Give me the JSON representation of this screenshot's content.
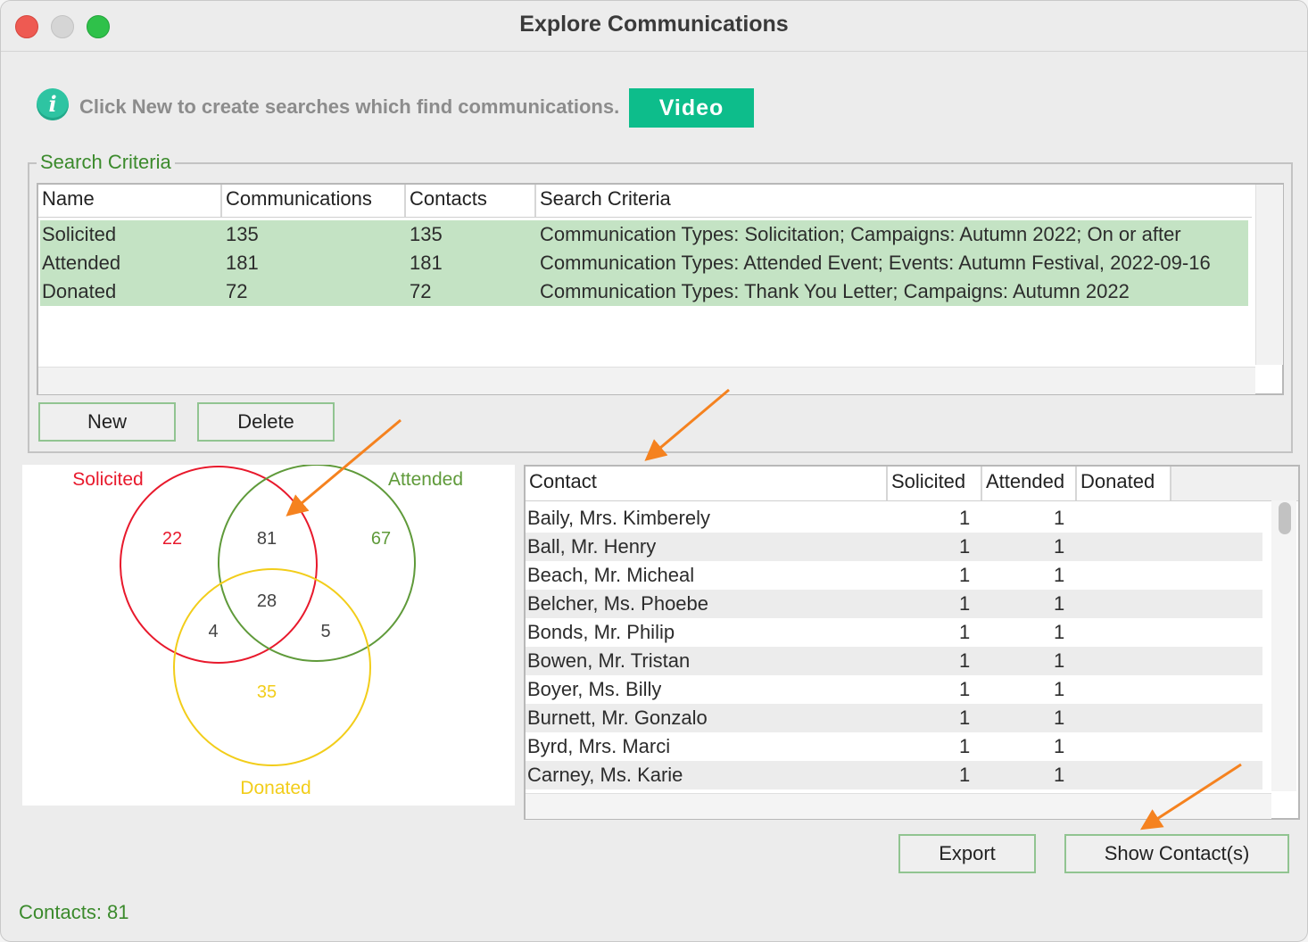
{
  "window": {
    "title": "Explore Communications"
  },
  "info": {
    "text": "Click New to create searches which find communications.",
    "video_label": "Video",
    "icon": "info-icon"
  },
  "search_criteria": {
    "legend": "Search Criteria",
    "columns": [
      "Name",
      "Communications",
      "Contacts",
      "Search Criteria"
    ],
    "rows": [
      {
        "name": "Solicited",
        "communications": "135",
        "contacts": "135",
        "criteria": "Communication Types: Solicitation; Campaigns: Autumn 2022; On or after"
      },
      {
        "name": "Attended",
        "communications": "181",
        "contacts": "181",
        "criteria": "Communication Types: Attended Event; Events: Autumn Festival, 2022-09-16"
      },
      {
        "name": "Donated",
        "communications": "72",
        "contacts": "72",
        "criteria": "Communication Types: Thank You Letter; Campaigns: Autumn 2022"
      }
    ],
    "new_label": "New",
    "delete_label": "Delete",
    "selected_row_color": "#c4e3c4"
  },
  "venn": {
    "sets": [
      {
        "label": "Solicited",
        "color": "#e8192c"
      },
      {
        "label": "Attended",
        "color": "#5f9a3a"
      },
      {
        "label": "Donated",
        "color": "#f2cd1a"
      }
    ],
    "regions": {
      "solicited_only": "22",
      "attended_only": "67",
      "donated_only": "35",
      "solicited_attended": "81",
      "solicited_donated": "4",
      "attended_donated": "5",
      "all_three": "28"
    }
  },
  "contacts": {
    "columns": [
      "Contact",
      "Solicited",
      "Attended",
      "Donated"
    ],
    "rows": [
      {
        "contact": "Baily, Mrs. Kimberely",
        "solicited": "1",
        "attended": "1",
        "donated": ""
      },
      {
        "contact": "Ball, Mr. Henry",
        "solicited": "1",
        "attended": "1",
        "donated": ""
      },
      {
        "contact": "Beach, Mr. Micheal",
        "solicited": "1",
        "attended": "1",
        "donated": ""
      },
      {
        "contact": "Belcher, Ms. Phoebe",
        "solicited": "1",
        "attended": "1",
        "donated": ""
      },
      {
        "contact": "Bonds, Mr. Philip",
        "solicited": "1",
        "attended": "1",
        "donated": ""
      },
      {
        "contact": "Bowen, Mr. Tristan",
        "solicited": "1",
        "attended": "1",
        "donated": ""
      },
      {
        "contact": "Boyer, Ms. Billy",
        "solicited": "1",
        "attended": "1",
        "donated": ""
      },
      {
        "contact": "Burnett, Mr. Gonzalo",
        "solicited": "1",
        "attended": "1",
        "donated": ""
      },
      {
        "contact": "Byrd, Mrs. Marci",
        "solicited": "1",
        "attended": "1",
        "donated": ""
      },
      {
        "contact": "Carney, Ms. Karie",
        "solicited": "1",
        "attended": "1",
        "donated": ""
      }
    ],
    "export_label": "Export",
    "show_contacts_label": "Show Contact(s)"
  },
  "status": {
    "text": "Contacts: 81"
  },
  "annotation_color": "#f5821f"
}
